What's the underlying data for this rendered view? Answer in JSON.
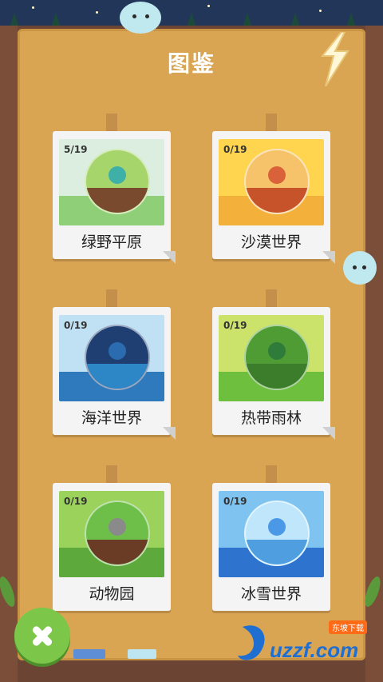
{
  "header": {
    "title": "图鉴"
  },
  "cards": [
    {
      "label": "绿野平原",
      "count": "5/19",
      "sky": "#dbeee0",
      "globe": "#a6d66b",
      "soil": "#7a4a2e",
      "ground": "#8fcf78",
      "monster": "#3fb0a8"
    },
    {
      "label": "沙漠世界",
      "count": "0/19",
      "sky": "#ffd54f",
      "globe": "#f6c36a",
      "soil": "#c7532a",
      "ground": "#f3b13c",
      "monster": "#d9623a"
    },
    {
      "label": "海洋世界",
      "count": "0/19",
      "sky": "#bfe1f3",
      "globe": "#1f3f73",
      "soil": "#2d86c6",
      "ground": "#2f79bd",
      "monster": "#2b6cb0"
    },
    {
      "label": "热带雨林",
      "count": "0/19",
      "sky": "#cbe36a",
      "globe": "#4f9c34",
      "soil": "#3b7d2a",
      "ground": "#6fbf3e",
      "monster": "#2e7b3a"
    },
    {
      "label": "动物园",
      "count": "0/19",
      "sky": "#9bd25c",
      "globe": "#6dbf49",
      "soil": "#6a3c26",
      "ground": "#5ea93c",
      "monster": "#8a8a8a"
    },
    {
      "label": "冰雪世界",
      "count": "0/19",
      "sky": "#7fc3f0",
      "globe": "#bfe6fb",
      "soil": "#4f9fe0",
      "ground": "#2e74cf",
      "monster": "#4a98e6"
    }
  ],
  "controls": {
    "close_icon": "close-x-icon"
  },
  "watermark": {
    "brand": "uzzf.com",
    "tag": "东坡下载"
  },
  "colors": {
    "board": "#d9a553",
    "frame": "#6b4433",
    "close": "#7cc74a"
  }
}
